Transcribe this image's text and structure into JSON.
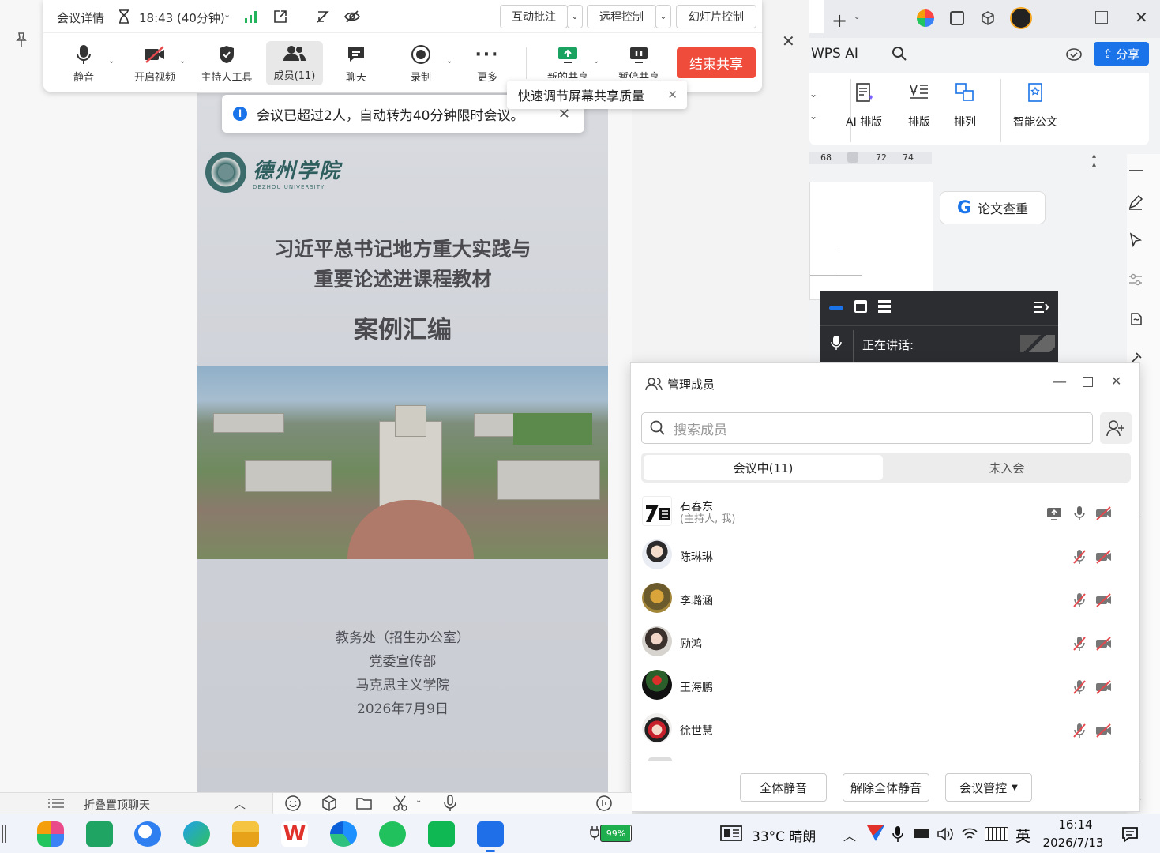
{
  "meeting": {
    "details_label": "会议详情",
    "timer": "18:43 (40分钟)",
    "annotate_label": "互动批注",
    "remote_label": "远程控制",
    "slides_label": "幻灯片控制",
    "tools": [
      {
        "label": "静音"
      },
      {
        "label": "开启视频"
      },
      {
        "label": "主持人工具"
      },
      {
        "label": "成员(11)"
      },
      {
        "label": "聊天"
      },
      {
        "label": "录制"
      },
      {
        "label": "更多"
      },
      {
        "label": "新的共享"
      },
      {
        "label": "暂停共享"
      }
    ],
    "end_share_label": "结束共享",
    "notice": "会议已超过2人，自动转为40分钟限时会议。",
    "tooltip": "快速调节屏幕共享质量"
  },
  "document": {
    "school_cn": "德州学院",
    "school_en": "DEZHOU UNIVERSITY",
    "title_line1": "习近平总书记地方重大实践与",
    "title_line2": "重要论述进课程教材",
    "title_line3": "案例汇编",
    "dept1": "教务处（招生办公室）",
    "dept2": "党委宣传部",
    "dept3": "马克思主义学院",
    "date": "2026年7月9日"
  },
  "wps": {
    "wps_ai": "WPS AI",
    "share_label": "分享",
    "ribbon": [
      {
        "label": "AI 排版"
      },
      {
        "label": "排版"
      },
      {
        "label": "排列"
      },
      {
        "label": "智能公文"
      }
    ],
    "ruler": [
      "68",
      "72",
      "74"
    ],
    "lunwen": "论文查重"
  },
  "speaking": {
    "label": "正在讲话:"
  },
  "members_panel": {
    "title": "管理成员",
    "search_placeholder": "搜索成员",
    "tab_in": "会议中(11)",
    "tab_out": "未入会",
    "members": [
      {
        "name": "石春东",
        "sub": "(主持人, 我)"
      },
      {
        "name": "陈琳琳"
      },
      {
        "name": "李璐涵"
      },
      {
        "name": "励鸿"
      },
      {
        "name": "王海鹏"
      },
      {
        "name": "徐世慧"
      }
    ],
    "mute_all": "全体静音",
    "unmute_all": "解除全体静音",
    "control": "会议管控"
  },
  "chatbar": {
    "fold_label": "折叠置顶聊天"
  },
  "taskbar": {
    "battery": "99%",
    "weather": "33°C  晴朗",
    "ime": "英",
    "time": "16:14",
    "date": "2026/7/13",
    "colors": {
      "end_share": "#f04c3b",
      "share_btn": "#1a73e8",
      "muted_red": "#e5484d"
    }
  }
}
